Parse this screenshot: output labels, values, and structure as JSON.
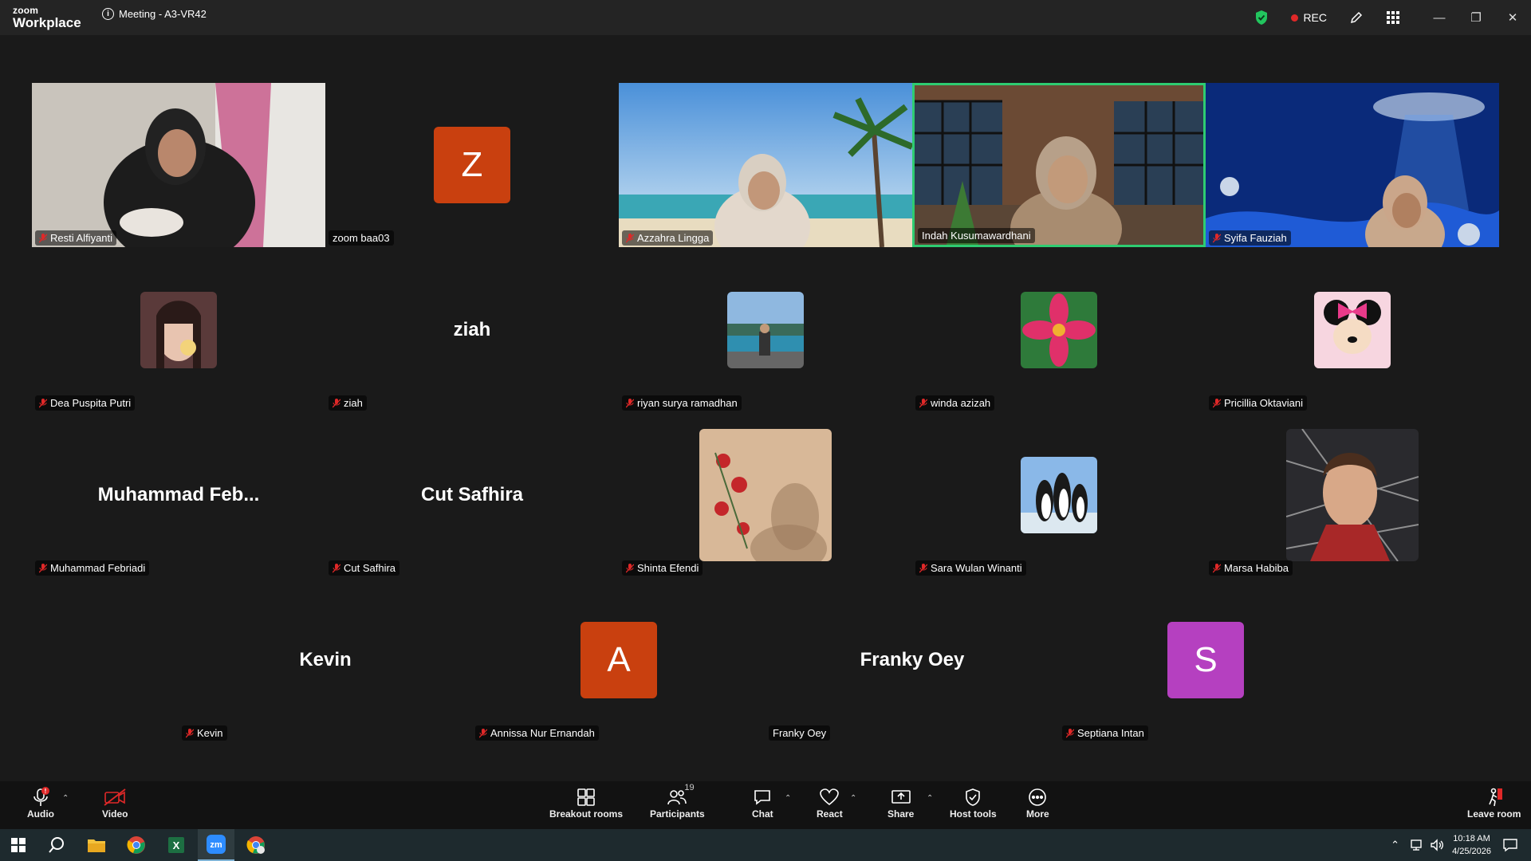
{
  "app": {
    "logo_top": "zoom",
    "logo_bottom": "Workplace",
    "meeting_title": "Meeting - A3-VR42",
    "rec_label": "REC"
  },
  "participants": [
    {
      "name": "Resti Alfiyanti",
      "muted": true,
      "kind": "video"
    },
    {
      "name": "zoom baa03",
      "muted": false,
      "kind": "letter",
      "letter": "Z",
      "color": "#c9400f"
    },
    {
      "name": "Azzahra Lingga",
      "muted": true,
      "kind": "video"
    },
    {
      "name": "Indah Kusumawardhani",
      "muted": false,
      "kind": "video",
      "active": true
    },
    {
      "name": "Syifa Fauziah",
      "muted": true,
      "kind": "video"
    },
    {
      "name": "Dea Puspita Putri",
      "muted": true,
      "kind": "pic"
    },
    {
      "name": "ziah",
      "muted": true,
      "kind": "text",
      "display": "ziah"
    },
    {
      "name": "riyan surya ramadhan",
      "muted": true,
      "kind": "pic"
    },
    {
      "name": "winda azizah",
      "muted": true,
      "kind": "pic"
    },
    {
      "name": "Pricillia Oktaviani",
      "muted": true,
      "kind": "pic"
    },
    {
      "name": "Muhammad Febriadi",
      "muted": true,
      "kind": "text",
      "display": "Muhammad  Feb..."
    },
    {
      "name": "Cut Safhira",
      "muted": true,
      "kind": "text",
      "display": "Cut Safhira"
    },
    {
      "name": "Shinta Efendi",
      "muted": true,
      "kind": "pic"
    },
    {
      "name": "Sara Wulan Winanti",
      "muted": true,
      "kind": "pic"
    },
    {
      "name": "Marsa Habiba",
      "muted": true,
      "kind": "pic"
    },
    {
      "name": "Kevin",
      "muted": true,
      "kind": "text",
      "display": "Kevin"
    },
    {
      "name": "Annissa Nur Ernandah",
      "muted": true,
      "kind": "letter",
      "letter": "A",
      "color": "#c9400f"
    },
    {
      "name": "Franky Oey",
      "muted": false,
      "kind": "text",
      "display": "Franky Oey"
    },
    {
      "name": "Septiana Intan",
      "muted": true,
      "kind": "letter",
      "letter": "S",
      "color": "#b540c0"
    }
  ],
  "toolbar": {
    "audio": "Audio",
    "video": "Video",
    "breakout": "Breakout rooms",
    "participants": "Participants",
    "participants_count": "19",
    "chat": "Chat",
    "react": "React",
    "share": "Share",
    "host_tools": "Host tools",
    "more": "More",
    "leave": "Leave room"
  },
  "taskbar": {
    "time": "10:18 AM",
    "date": "4/25/2026"
  }
}
